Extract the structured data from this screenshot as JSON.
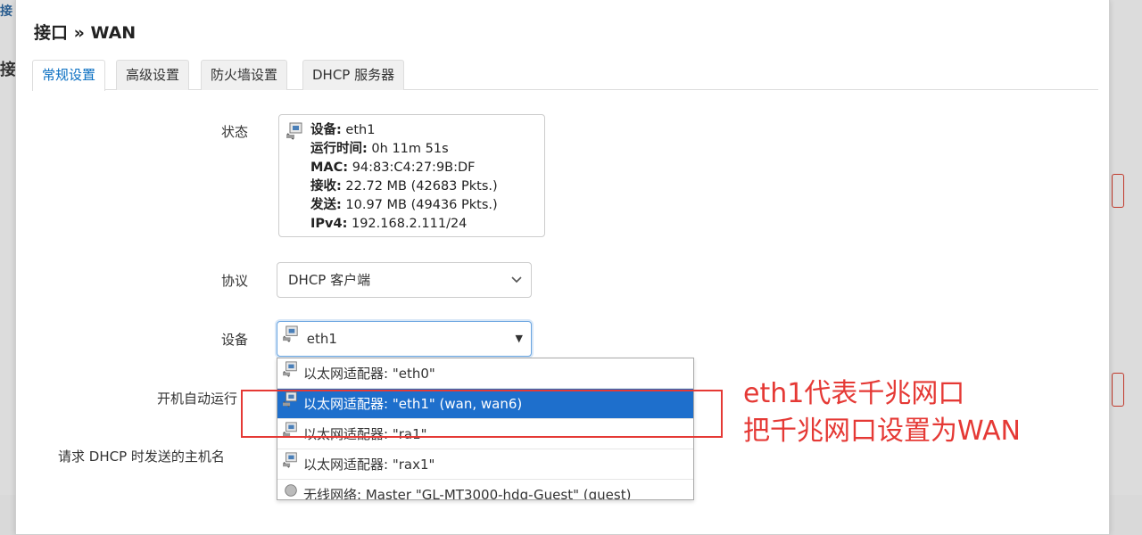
{
  "background": {
    "fragment_top": "接",
    "fragment_left": "接"
  },
  "modal": {
    "title": "接口 » WAN"
  },
  "tabs": [
    {
      "label": "常规设置",
      "active": true
    },
    {
      "label": "高级设置",
      "active": false
    },
    {
      "label": "防火墙设置",
      "active": false
    },
    {
      "label": "DHCP 服务器",
      "active": false
    }
  ],
  "fields": {
    "status_label": "状态",
    "protocol_label": "协议",
    "device_label": "设备",
    "autostart_label": "开机自动运行",
    "hostname_label": "请求 DHCP 时发送的主机名"
  },
  "status": {
    "device_key": "设备:",
    "device_val": "eth1",
    "uptime_key": "运行时间:",
    "uptime_val": "0h 11m 51s",
    "mac_key": "MAC:",
    "mac_val": "94:83:C4:27:9B:DF",
    "rx_key": "接收:",
    "rx_val": "22.72 MB (42683 Pkts.)",
    "tx_key": "发送:",
    "tx_val": "10.97 MB (49436 Pkts.)",
    "ipv4_key": "IPv4:",
    "ipv4_val": "192.168.2.111/24"
  },
  "protocol_select": {
    "value": "DHCP 客户端"
  },
  "device_select": {
    "value": "eth1"
  },
  "dropdown_options": [
    {
      "label": "以太网适配器: \"eth0\"",
      "selected": false
    },
    {
      "label": "以太网适配器: \"eth1\" (wan, wan6)",
      "selected": true
    },
    {
      "label": "以太网适配器: \"ra1\"",
      "selected": false
    },
    {
      "label": "以太网适配器: \"rax1\"",
      "selected": false
    },
    {
      "label": "无线网络: Master \"GL-MT3000-hdg-Guest\" (guest)",
      "selected": false
    }
  ],
  "annotation": {
    "line1": "eth1代表千兆网口",
    "line2": "把千兆网口设置为WAN"
  },
  "colors": {
    "accent": "#0a6fc2",
    "selected_option": "#1e6fcc",
    "annotation": "#e53935"
  }
}
